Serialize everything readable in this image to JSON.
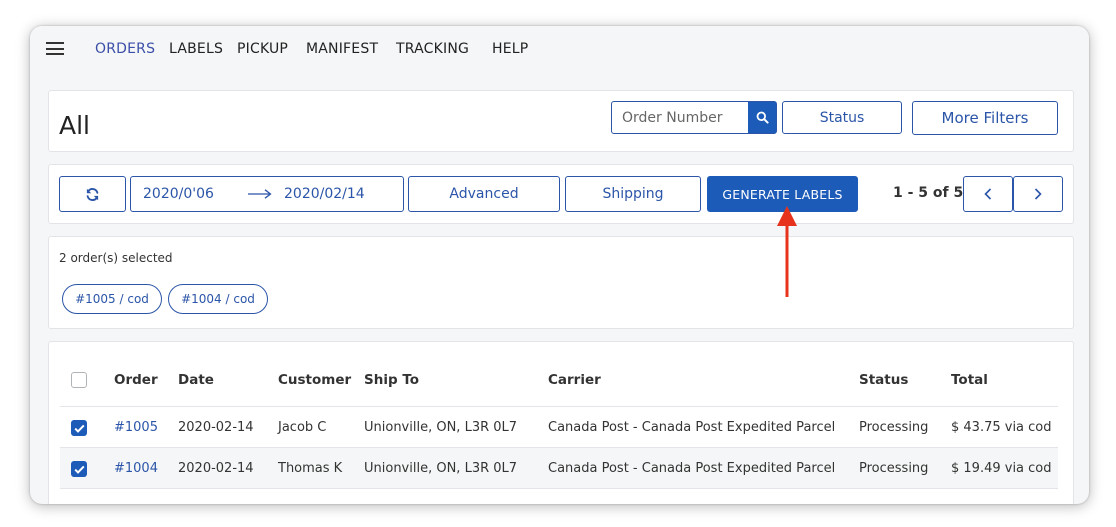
{
  "nav": {
    "items": [
      {
        "label": "ORDERS",
        "active": true
      },
      {
        "label": "LABELS"
      },
      {
        "label": "PICKUP"
      },
      {
        "label": "MANIFEST"
      },
      {
        "label": "TRACKING"
      },
      {
        "label": "HELP"
      }
    ]
  },
  "header": {
    "title": "All",
    "search_placeholder": "Order Number",
    "status_label": "Status",
    "more_filters_label": "More Filters"
  },
  "toolbar": {
    "date_from": "2020/0'06",
    "date_to": "2020/02/14",
    "advanced_label": "Advanced",
    "shipping_label": "Shipping",
    "generate_labels_label": "GENERATE LABELS",
    "pagination": "1 - 5 of 5"
  },
  "selection": {
    "summary": "2 order(s) selected",
    "chips": [
      "#1005 / cod",
      "#1004 / cod"
    ]
  },
  "table": {
    "columns": [
      "Order",
      "Date",
      "Customer",
      "Ship To",
      "Carrier",
      "Status",
      "Total"
    ],
    "rows": [
      {
        "order": "#1005",
        "date": "2020-02-14",
        "customer": "Jacob C",
        "ship_to": "Unionville, ON, L3R 0L7",
        "carrier": "Canada Post - Canada Post Expedited Parcel",
        "status": "Processing",
        "total": "$ 43.75 via cod",
        "checked": true
      },
      {
        "order": "#1004",
        "date": "2020-02-14",
        "customer": "Thomas K",
        "ship_to": "Unionville, ON, L3R 0L7",
        "carrier": "Canada Post - Canada Post Expedited Parcel",
        "status": "Processing",
        "total": "$ 19.49 via cod",
        "checked": true
      }
    ]
  },
  "colors": {
    "primary": "#1d5bb8",
    "link": "#2b55a8",
    "annotation_arrow": "#e8331c"
  }
}
